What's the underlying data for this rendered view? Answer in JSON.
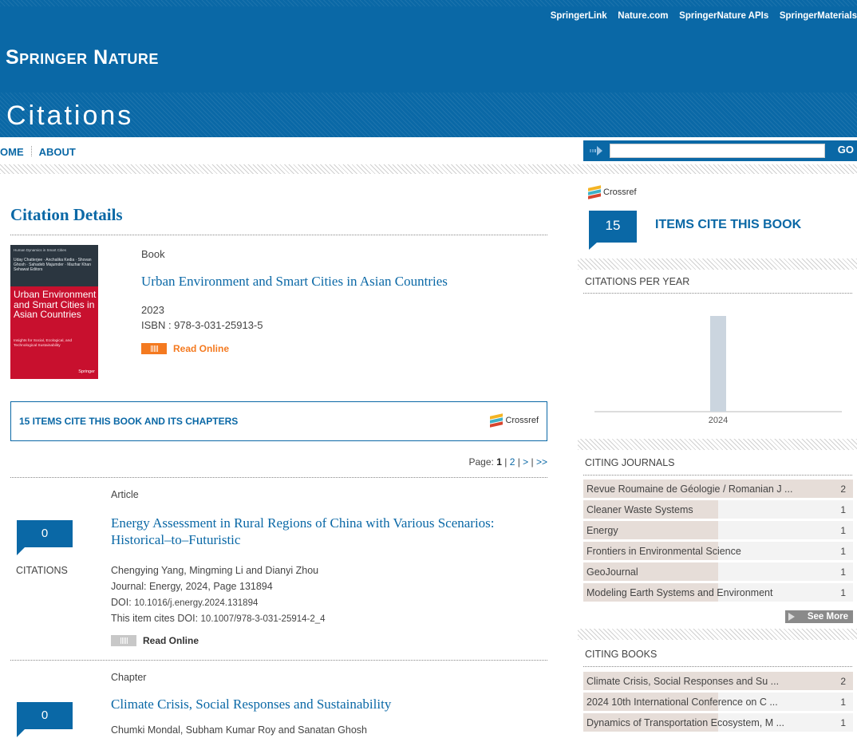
{
  "header": {
    "top_links": [
      "SpringerLink",
      "Nature.com",
      "SpringerNature APIs",
      "SpringerMaterials"
    ],
    "brand": "Springer Nature",
    "section_title": "Citations"
  },
  "nav": {
    "items": [
      "OME",
      "ABOUT"
    ],
    "search_placeholder": "",
    "search_button": "GO"
  },
  "details": {
    "heading": "Citation Details",
    "cover": {
      "series": "Human Dynamics in Smart Cities",
      "authors": "Uday Chatterjee · Anchalika Kedia · Shovan Ghosh · Sahadeb Majumder · Mazhar Khan Sehawat  Editors",
      "title": "Urban Environment and Smart Cities in Asian Countries",
      "subtitle": "Insights for Social, Ecological, and Technological Sustainability",
      "publisher": "Springer"
    },
    "type": "Book",
    "title": "Urban Environment and Smart Cities in Asian Countries",
    "year": "2023",
    "isbn": "ISBN : 978-3-031-25913-5",
    "read_online": "Read Online"
  },
  "cite_box": {
    "label": "15 ITEMS CITE THIS BOOK AND ITS CHAPTERS",
    "crossref": "Crossref"
  },
  "pagination": {
    "prefix": "Page:",
    "current": "1",
    "rest": [
      "2",
      ">",
      ">>"
    ]
  },
  "citations": [
    {
      "count": "0",
      "count_label": "CITATIONS",
      "type": "Article",
      "title": "Energy Assessment in Rural Regions of China with Various Scenarios: Historical–to–Futuristic",
      "authors": "Chengying Yang, Mingming Li and Dianyi Zhou",
      "journal": "Journal: Energy, 2024, Page 131894",
      "doi_label": "DOI:",
      "doi": "10.1016/j.energy.2024.131894",
      "cites_label": "This item cites DOI:",
      "cites_doi": "10.1007/978-3-031-25914-2_4",
      "read_online": "Read Online"
    },
    {
      "count": "0",
      "type": "Chapter",
      "title": "Climate Crisis, Social Responses and Sustainability",
      "authors": "Chumki Mondal, Subham Kumar Roy and Sanatan Ghosh"
    }
  ],
  "sidebar": {
    "crossref": "Crossref",
    "badge_count": "15",
    "badge_label": "ITEMS CITE THIS BOOK",
    "per_year_heading": "CITATIONS PER YEAR",
    "journals_heading": "CITING JOURNALS",
    "journals": [
      {
        "name": "Revue Roumaine de Géologie / Romanian J ...",
        "count": "2",
        "fraction": 1.0
      },
      {
        "name": "Cleaner Waste Systems",
        "count": "1",
        "fraction": 0.5
      },
      {
        "name": "Energy",
        "count": "1",
        "fraction": 0.5
      },
      {
        "name": "Frontiers in Environmental Science",
        "count": "1",
        "fraction": 0.5
      },
      {
        "name": "GeoJournal",
        "count": "1",
        "fraction": 0.5
      },
      {
        "name": "Modeling Earth Systems and Environment",
        "count": "1",
        "fraction": 0.5
      }
    ],
    "see_more": "See More",
    "books_heading": "CITING BOOKS",
    "books": [
      {
        "name": "Climate Crisis, Social Responses and Su ...",
        "count": "2",
        "fraction": 1.0
      },
      {
        "name": "2024 10th International Conference on C ...",
        "count": "1",
        "fraction": 0.5
      },
      {
        "name": "Dynamics of Transportation Ecosystem, M ...",
        "count": "1",
        "fraction": 0.5
      }
    ]
  },
  "chart_data": {
    "type": "bar",
    "categories": [
      "2024"
    ],
    "values": [
      15
    ],
    "xlabel": "",
    "ylabel": "",
    "grid": false
  },
  "colors": {
    "brand_blue": "#0a68a6",
    "read_online": "#f47a20",
    "chart_bar": "#cbd5df",
    "list_bar": "#e6ddd8"
  }
}
